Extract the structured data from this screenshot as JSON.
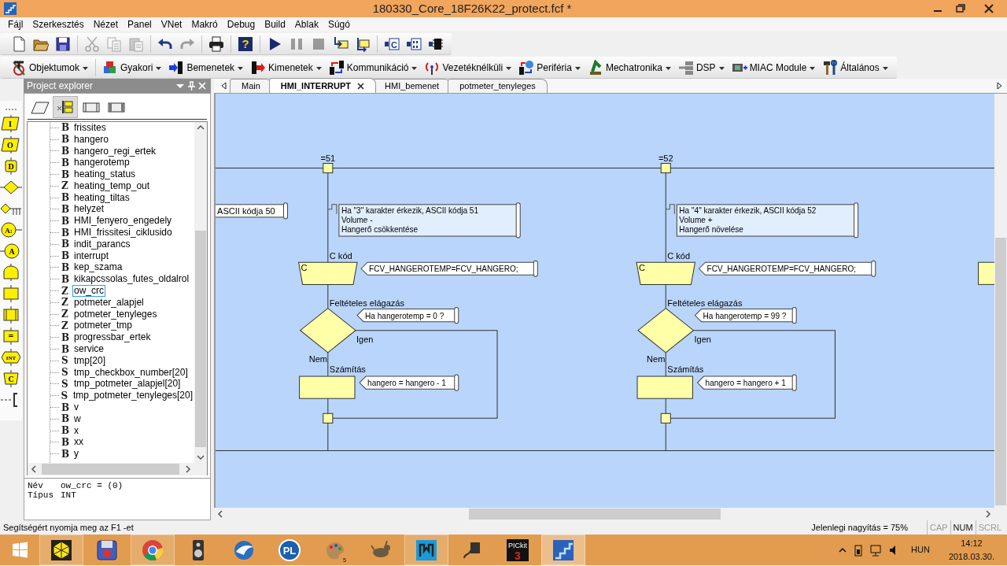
{
  "window": {
    "title": "180330_Core_18F26K22_protect.fcf *"
  },
  "menu": [
    "Fájl",
    "Szerkesztés",
    "Nézet",
    "Panel",
    "VNet",
    "Makró",
    "Debug",
    "Build",
    "Ablak",
    "Súgó"
  ],
  "toolbar_1": [
    {
      "kind": "new",
      "disabled": false
    },
    {
      "kind": "open",
      "disabled": false
    },
    {
      "kind": "save",
      "disabled": false
    },
    {
      "kind": "separator"
    },
    {
      "kind": "cut",
      "disabled": true
    },
    {
      "kind": "copy",
      "disabled": true
    },
    {
      "kind": "paste",
      "disabled": true
    },
    {
      "kind": "separator"
    },
    {
      "kind": "undo",
      "disabled": false
    },
    {
      "kind": "redo",
      "disabled": true
    },
    {
      "kind": "separator"
    },
    {
      "kind": "print",
      "disabled": false
    },
    {
      "kind": "separator"
    },
    {
      "kind": "help",
      "disabled": false,
      "glyph": "?"
    },
    {
      "kind": "separator"
    },
    {
      "kind": "run",
      "disabled": false
    },
    {
      "kind": "pause",
      "disabled": true
    },
    {
      "kind": "stop",
      "disabled": true
    },
    {
      "kind": "step_into",
      "disabled": false
    },
    {
      "kind": "step_over",
      "disabled": false
    },
    {
      "kind": "separator"
    },
    {
      "kind": "compile_c",
      "disabled": false,
      "glyph": "C"
    },
    {
      "kind": "compile_hex",
      "disabled": false
    },
    {
      "kind": "program",
      "disabled": false
    }
  ],
  "toolbar_2": [
    "Objektumok",
    "Gyakori",
    "Bemenetek",
    "Kimenetek",
    "Kommunikáció",
    "Vezetéknélküli",
    "Periféria",
    "Mechatronika",
    "DSP",
    "MIAC Module",
    "Általános"
  ],
  "palette": [
    {
      "kind": "input",
      "glyph": "I"
    },
    {
      "kind": "output",
      "glyph": "O"
    },
    {
      "kind": "delay",
      "glyph": "D"
    },
    {
      "kind": "decision"
    },
    {
      "kind": "switch"
    },
    {
      "kind": "connection",
      "glyph": "A:"
    },
    {
      "kind": "goto",
      "glyph": "A"
    },
    {
      "kind": "loop"
    },
    {
      "kind": "calculation"
    },
    {
      "kind": "macro"
    },
    {
      "kind": "component",
      "glyph": "="
    },
    {
      "kind": "interrupt",
      "glyph": "INT"
    },
    {
      "kind": "code",
      "glyph": "C"
    },
    {
      "kind": "comment"
    }
  ],
  "project_explorer": {
    "title": "Project explorer",
    "tabs": [
      {
        "kind": "ports",
        "selected": false
      },
      {
        "kind": "globals",
        "selected": true
      },
      {
        "kind": "macros",
        "selected": false
      },
      {
        "kind": "components",
        "selected": false
      }
    ],
    "items": [
      {
        "type": "B",
        "name": "frissites",
        "selected": false
      },
      {
        "type": "B",
        "name": "hangero",
        "selected": false
      },
      {
        "type": "B",
        "name": "hangero_regi_ertek",
        "selected": false
      },
      {
        "type": "B",
        "name": "hangerotemp",
        "selected": false
      },
      {
        "type": "B",
        "name": "heating_status",
        "selected": false
      },
      {
        "type": "Z",
        "name": "heating_temp_out",
        "selected": false
      },
      {
        "type": "B",
        "name": "heating_tiltas",
        "selected": false
      },
      {
        "type": "B",
        "name": "helyzet",
        "selected": false
      },
      {
        "type": "B",
        "name": "HMI_fenyero_engedely",
        "selected": false
      },
      {
        "type": "B",
        "name": "HMI_frissitesi_ciklusido",
        "selected": false
      },
      {
        "type": "B",
        "name": "indit_parancs",
        "selected": false
      },
      {
        "type": "B",
        "name": "interrupt",
        "selected": false
      },
      {
        "type": "B",
        "name": "kep_szama",
        "selected": false
      },
      {
        "type": "B",
        "name": "kikapcssolas_futes_oldalrol",
        "selected": false
      },
      {
        "type": "Z",
        "name": "ow_crc",
        "selected": true
      },
      {
        "type": "Z",
        "name": "potmeter_alapjel",
        "selected": false
      },
      {
        "type": "Z",
        "name": "potmeter_tenyleges",
        "selected": false
      },
      {
        "type": "Z",
        "name": "potmeter_tmp",
        "selected": false
      },
      {
        "type": "B",
        "name": "progressbar_ertek",
        "selected": false
      },
      {
        "type": "B",
        "name": "service",
        "selected": false
      },
      {
        "type": "S",
        "name": "tmp[20]",
        "selected": false
      },
      {
        "type": "S",
        "name": "tmp_checkbox_number[20]",
        "selected": false
      },
      {
        "type": "S",
        "name": "tmp_potmeter_alapjel[20]",
        "selected": false
      },
      {
        "type": "S",
        "name": "tmp_potmeter_tenyleges[20]",
        "selected": false
      },
      {
        "type": "B",
        "name": "v",
        "selected": false
      },
      {
        "type": "B",
        "name": "w",
        "selected": false
      },
      {
        "type": "B",
        "name": "x",
        "selected": false
      },
      {
        "type": "B",
        "name": "xx",
        "selected": false
      },
      {
        "type": "B",
        "name": "y",
        "selected": false
      }
    ],
    "info": [
      {
        "label": "Név",
        "value": "ow_crc = (0)"
      },
      {
        "label": "Típus",
        "value": "INT"
      }
    ]
  },
  "tabs": [
    {
      "label": "Main",
      "selected": false
    },
    {
      "label": "HMI_INTERRUPT",
      "selected": true
    },
    {
      "label": "HMI_bemenet",
      "selected": false
    },
    {
      "label": "potmeter_tenyleges",
      "selected": false
    }
  ],
  "canvas": {
    "fragments": [
      {
        "kind": "comment",
        "text": "ASCII kódja 50"
      },
      {
        "kind": "calculation"
      }
    ],
    "branches": [
      {
        "case": "=51",
        "comment": [
          "Ha \"3\" karakter érkezik, ASCII kódja 51",
          "Volume -",
          "Hangerő csökkentése"
        ],
        "code_label": "C kód",
        "code_glyph": "C",
        "code": "FCV_HANGEROTEMP=FCV_HANGERO;",
        "decision_label": "Feltételes elágazás",
        "condition": "Ha hangerotemp = 0 ?",
        "yes": "Igen",
        "no": "Nem",
        "calc_label": "Számítás",
        "calc": "hangero = hangero - 1"
      },
      {
        "case": "=52",
        "comment": [
          "Ha \"4\" karakter érkezik, ASCII kódja 52",
          "Volume +",
          "Hangerő növelése"
        ],
        "code_label": "C kód",
        "code_glyph": "C",
        "code": "FCV_HANGEROTEMP=FCV_HANGERO;",
        "decision_label": "Feltételes elágazás",
        "condition": "Ha hangerotemp = 99 ?",
        "yes": "Igen",
        "no": "Nem",
        "calc_label": "Számítás",
        "calc": "hangero = hangero + 1"
      }
    ]
  },
  "status_bar": {
    "help": "Segítségért nyomja meg az F1 -et",
    "zoom": "Jelenlegi nagyítás = 75%",
    "indicators": [
      {
        "label": "CAP",
        "on": false
      },
      {
        "label": "NUM",
        "on": true
      },
      {
        "label": "SCRL",
        "on": false
      }
    ]
  },
  "taskbar": {
    "apps": [
      {
        "kind": "cube",
        "running": true,
        "active": false
      },
      {
        "kind": "floppy",
        "running": false,
        "active": false
      },
      {
        "kind": "browser",
        "running": true,
        "active": false
      },
      {
        "kind": "speaker",
        "running": false,
        "active": false
      },
      {
        "kind": "mail",
        "running": false,
        "active": false
      },
      {
        "kind": "circle",
        "glyph": "PL",
        "running": false,
        "active": false
      },
      {
        "kind": "palette",
        "count": "5",
        "running": false,
        "active": false
      },
      {
        "kind": "animal",
        "running": false,
        "active": false
      },
      {
        "kind": "tile",
        "running": true,
        "active": false
      },
      {
        "kind": "plug",
        "running": false,
        "active": false
      },
      {
        "kind": "dark",
        "glyph": "PICkit",
        "sub": "3",
        "running": false,
        "active": false
      },
      {
        "kind": "stairs",
        "running": true,
        "active": true
      }
    ],
    "language": "HUN",
    "time": "14:12",
    "date": "2018.03.30."
  }
}
